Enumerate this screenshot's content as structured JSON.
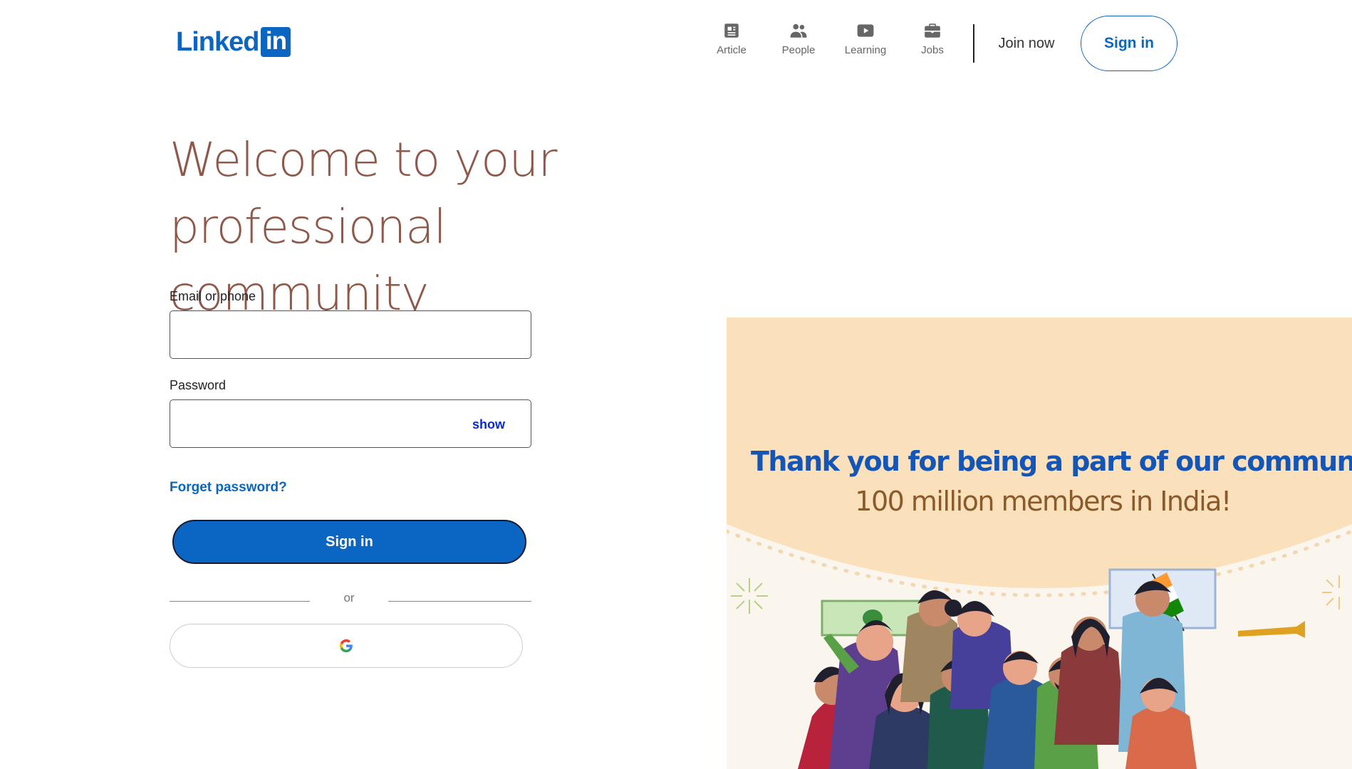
{
  "header": {
    "logo_word": "Linked",
    "logo_box": "in",
    "nav": [
      {
        "label": "Article",
        "icon": "newspaper-icon"
      },
      {
        "label": "People",
        "icon": "people-icon"
      },
      {
        "label": "Learning",
        "icon": "play-video-icon"
      },
      {
        "label": "Jobs",
        "icon": "briefcase-icon"
      }
    ],
    "join_now": "Join now",
    "sign_in": "Sign in"
  },
  "hero": {
    "title_line1": "Welcome to your",
    "title_line2": "professional community"
  },
  "form": {
    "email_label": "Email or phone",
    "email_value": "",
    "password_label": "Password",
    "password_value": "",
    "show_label": "show",
    "forgot_label": "Forget password?",
    "sign_in_label": "Sign in",
    "or_label": "or",
    "google_icon": "google-g-icon"
  },
  "promo": {
    "line1": "Thank you for being a part of our community.",
    "line2": "100 million members in India!"
  },
  "colors": {
    "brand": "#0a66c2",
    "hero_text": "#8f5849",
    "promo_bg": "#fae0bb",
    "promo_line1": "#1455b8",
    "promo_line2": "#8a5a2a"
  }
}
